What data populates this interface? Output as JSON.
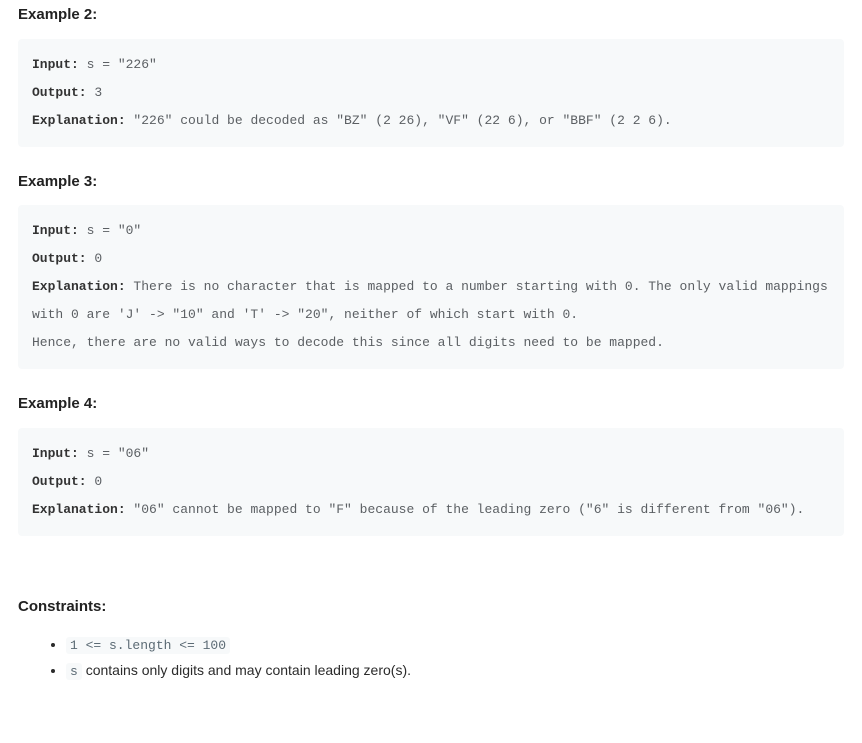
{
  "labels": {
    "input": "Input:",
    "output": "Output:",
    "explanation": "Explanation:"
  },
  "examples": [
    {
      "heading": "Example 2:",
      "input": " s = \"226\"",
      "output": " 3",
      "explanation": " \"226\" could be decoded as \"BZ\" (2 26), \"VF\" (22 6), or \"BBF\" (2 2 6)."
    },
    {
      "heading": "Example 3:",
      "input": " s = \"0\"",
      "output": " 0",
      "explanation": " There is no character that is mapped to a number starting with 0. The only valid mappings with 0 are 'J' -> \"10\" and 'T' -> \"20\", neither of which start with 0.\nHence, there are no valid ways to decode this since all digits need to be mapped."
    },
    {
      "heading": "Example 4:",
      "input": " s = \"06\"",
      "output": " 0",
      "explanation": " \"06\" cannot be mapped to \"F\" because of the leading zero (\"6\" is different from \"06\")."
    }
  ],
  "constraints": {
    "heading": "Constraints:",
    "item1_code": "1 <= s.length <= 100",
    "item2_code": "s",
    "item2_text": " contains only digits and may contain leading zero(s)."
  }
}
